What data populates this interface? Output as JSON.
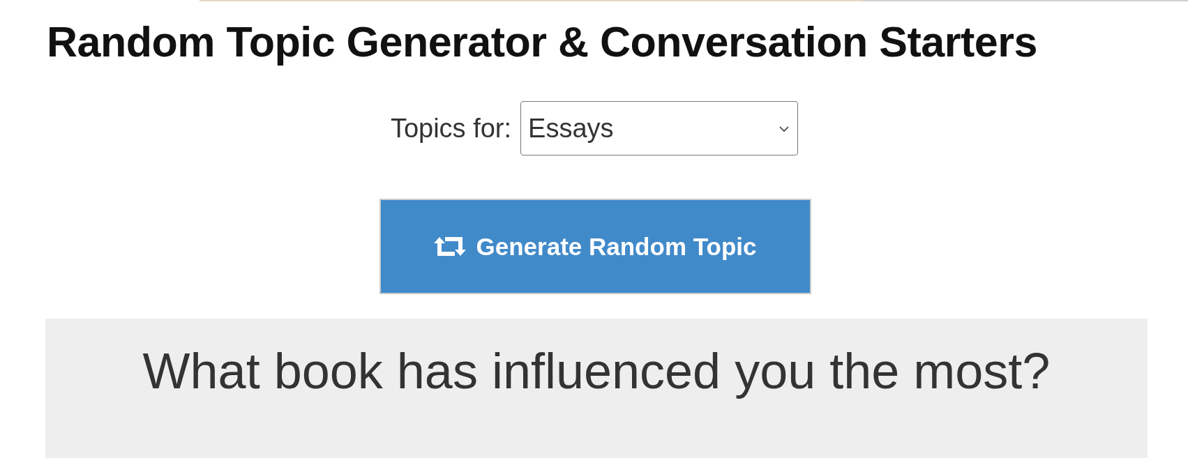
{
  "page": {
    "title": "Random Topic Generator & Conversation Starters"
  },
  "topic_picker": {
    "label": "Topics for:",
    "value": "Essays"
  },
  "generate_button": {
    "label": "Generate Random Topic"
  },
  "topic_card": {
    "text": "What book has influenced you the most?"
  }
}
